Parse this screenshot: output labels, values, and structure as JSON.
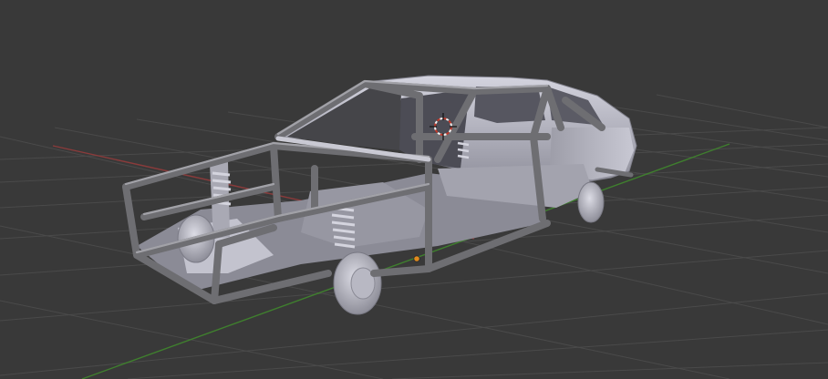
{
  "viewport": {
    "background": "#393939",
    "grid_color": "#4a4a4a",
    "x_axis_color": "#8a3b3b",
    "y_axis_color": "#3f7f2e",
    "model_color": "#bdbdc9",
    "tube_color": "#6e6e72",
    "origin_color": "#e08a1e",
    "cursor_color": "#c0392b",
    "icons": [
      "3d-cursor-icon",
      "object-origin-icon"
    ]
  }
}
